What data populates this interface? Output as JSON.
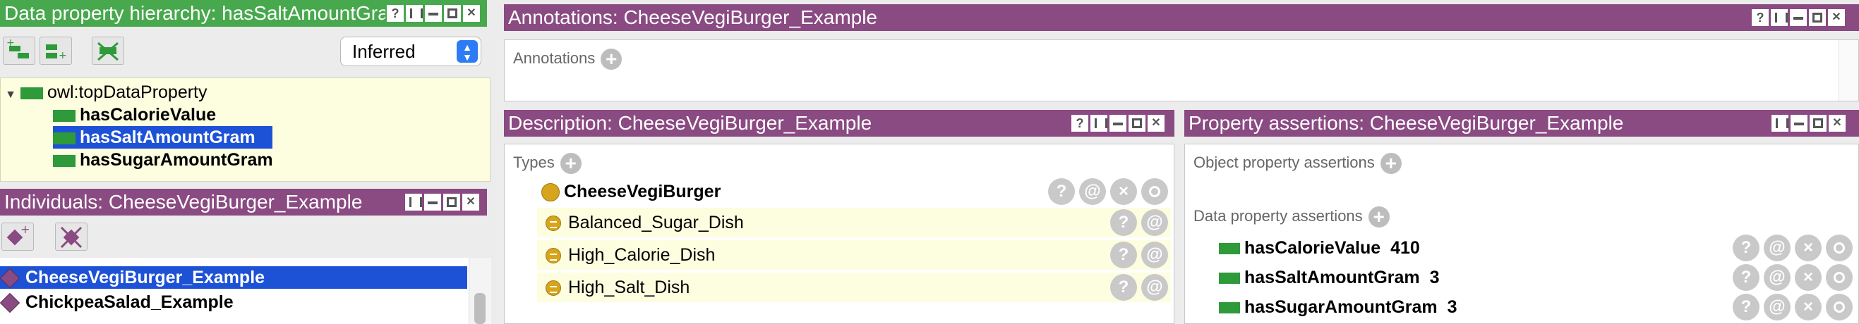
{
  "data_hierarchy": {
    "title": "Data property hierarchy: hasSaltAmountGram",
    "reasoner_select": "Inferred",
    "root": "owl:topDataProperty",
    "children": [
      "hasCalorieValue",
      "hasSaltAmountGram",
      "hasSugarAmountGram"
    ],
    "selected": "hasSaltAmountGram"
  },
  "individuals": {
    "title": "Individuals: CheeseVegiBurger_Example",
    "items": [
      "CheeseVegiBurger_Example",
      "ChickpeaSalad_Example"
    ],
    "selected": "CheeseVegiBurger_Example"
  },
  "annotations": {
    "title": "Annotations: CheeseVegiBurger_Example",
    "section_label": "Annotations"
  },
  "description": {
    "title": "Description: CheeseVegiBurger_Example",
    "types_label": "Types",
    "asserted_type": "CheeseVegiBurger",
    "inferred_types": [
      "Balanced_Sugar_Dish",
      "High_Calorie_Dish",
      "High_Salt_Dish"
    ]
  },
  "property_assertions": {
    "title": "Property assertions: CheeseVegiBurger_Example",
    "object_label": "Object property assertions",
    "data_label": "Data property assertions",
    "data_assertions": [
      {
        "property": "hasCalorieValue",
        "value": "410"
      },
      {
        "property": "hasSaltAmountGram",
        "value": "3"
      },
      {
        "property": "hasSugarAmountGram",
        "value": "3"
      }
    ]
  },
  "icons": {
    "help": "?",
    "annotate": "@",
    "delete": "×",
    "add": "+"
  },
  "colors": {
    "hierarchy_header": "#48a84e",
    "view_header": "#8a4a82",
    "selection": "#1e52d6",
    "inferred_background": "#fdfde0",
    "data_property": "#2f9a3a",
    "class": "#d6a51c"
  }
}
